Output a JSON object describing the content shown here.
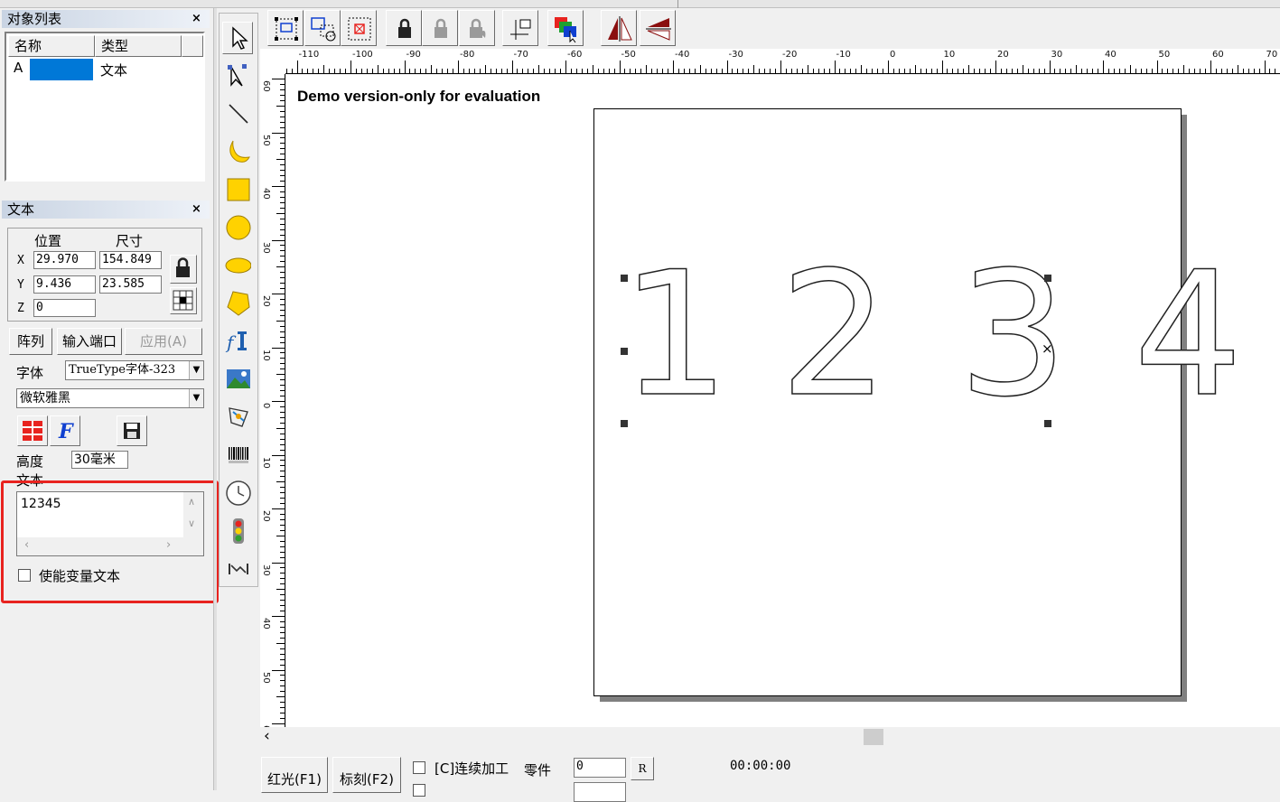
{
  "object_list": {
    "title": "对象列表",
    "close": "×",
    "columns": [
      "名称",
      "类型"
    ],
    "rows": [
      {
        "name": "A",
        "type": "文本"
      }
    ]
  },
  "text_panel": {
    "title": "文本",
    "close": "×",
    "position_label": "位置",
    "size_label": "尺寸",
    "x_label": "X",
    "y_label": "Y",
    "z_label": "Z",
    "x_value": "29.970",
    "y_value": "9.436",
    "z_value": "0",
    "width_value": "154.849",
    "height_value": "23.585",
    "array_button": "阵列",
    "input_port_button": "输入端口",
    "apply_button": "应用(A)",
    "font_label": "字体",
    "font_type": "TrueType字体-323",
    "font_name": "微软雅黑",
    "height_label": "高度",
    "height_field": "30毫米",
    "text_label": "文本",
    "text_value": "12345",
    "variable_text_label": "使能变量文本"
  },
  "canvas": {
    "demo_notice": "Demo version-only for evaluation",
    "digits": [
      "1",
      "2",
      "3",
      "4"
    ]
  },
  "ruler": {
    "h_labels": [
      "-110",
      "-100",
      "-90",
      "-80",
      "-70",
      "-60",
      "-50",
      "-40",
      "-30",
      "-20",
      "-10",
      "0",
      "10",
      "20",
      "30",
      "40",
      "50",
      "60",
      "70"
    ],
    "v_labels": [
      "60",
      "50",
      "40",
      "30",
      "20",
      "10",
      "0",
      "10",
      "20",
      "30",
      "40",
      "50",
      "60"
    ]
  },
  "bottom_bar": {
    "red_light_button": "红光(F1)",
    "mark_button": "标刻(F2)",
    "continuous_label": "[C]连续加工",
    "parts_label": "零件",
    "parts_value": "0",
    "r_button": "R",
    "time_value": "00:00:00"
  },
  "colors": {
    "accent_red": "#e8231f",
    "selection_blue": "#0078d7",
    "shape_yellow": "#ffd200"
  }
}
